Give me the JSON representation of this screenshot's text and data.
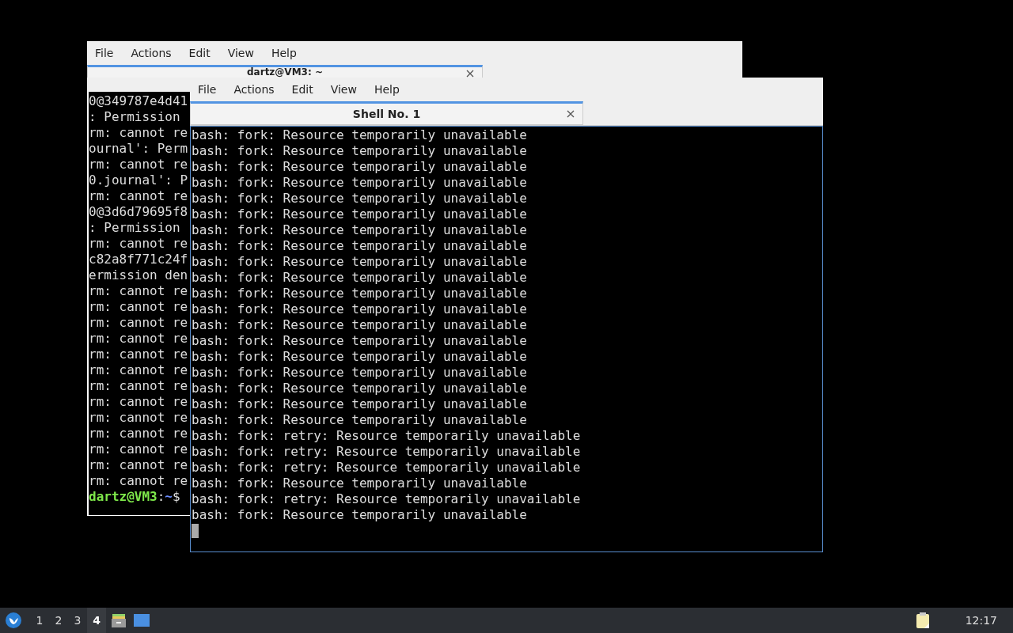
{
  "back_window": {
    "menu": [
      "File",
      "Actions",
      "Edit",
      "View",
      "Help"
    ],
    "tab": {
      "title": "dartz@VM3: ~",
      "selected": true
    },
    "lines": [
      "0@349787e4d41",
      ": Permission",
      "rm: cannot re",
      "ournal': Perm",
      "rm: cannot re",
      "0.journal': P",
      "rm: cannot re",
      "0@3d6d79695f8",
      ": Permission",
      "rm: cannot re",
      "c82a8f771c24f",
      "ermission den",
      "rm: cannot re",
      "rm: cannot re",
      "rm: cannot re",
      "rm: cannot re",
      "rm: cannot re",
      "rm: cannot re",
      "rm: cannot re",
      "rm: cannot re",
      "rm: cannot re",
      "rm: cannot re",
      "rm: cannot re",
      "rm: cannot re",
      "rm: cannot re"
    ],
    "prompt": {
      "user_host": "dartz@VM3",
      "separator": ":",
      "path": "~",
      "symbol": "$"
    }
  },
  "front_window": {
    "menu": [
      "File",
      "Actions",
      "Edit",
      "View",
      "Help"
    ],
    "tab": {
      "title": "Shell No. 1",
      "selected": true
    },
    "lines": [
      "bash: fork: Resource temporarily unavailable",
      "bash: fork: Resource temporarily unavailable",
      "bash: fork: Resource temporarily unavailable",
      "bash: fork: Resource temporarily unavailable",
      "bash: fork: Resource temporarily unavailable",
      "bash: fork: Resource temporarily unavailable",
      "bash: fork: Resource temporarily unavailable",
      "bash: fork: Resource temporarily unavailable",
      "bash: fork: Resource temporarily unavailable",
      "bash: fork: Resource temporarily unavailable",
      "bash: fork: Resource temporarily unavailable",
      "bash: fork: Resource temporarily unavailable",
      "bash: fork: Resource temporarily unavailable",
      "bash: fork: Resource temporarily unavailable",
      "bash: fork: Resource temporarily unavailable",
      "bash: fork: Resource temporarily unavailable",
      "bash: fork: Resource temporarily unavailable",
      "bash: fork: Resource temporarily unavailable",
      "bash: fork: Resource temporarily unavailable",
      "bash: fork: retry: Resource temporarily unavailable",
      "bash: fork: retry: Resource temporarily unavailable",
      "bash: fork: retry: Resource temporarily unavailable",
      "bash: fork: Resource temporarily unavailable",
      "bash: fork: retry: Resource temporarily unavailable",
      "bash: fork: Resource temporarily unavailable"
    ],
    "cursor": true
  },
  "taskbar": {
    "workspaces": [
      {
        "label": "1",
        "selected": false
      },
      {
        "label": "2",
        "selected": false
      },
      {
        "label": "3",
        "selected": false
      },
      {
        "label": "4",
        "selected": true
      }
    ],
    "clock": "12:17"
  }
}
